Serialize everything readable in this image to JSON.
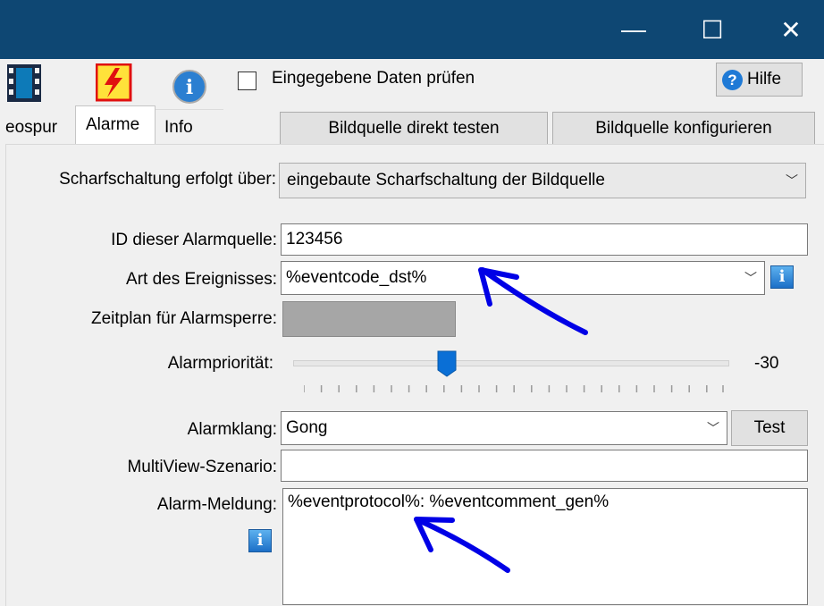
{
  "window": {
    "minimize_glyph": "—",
    "maximize_glyph": "☐",
    "close_glyph": "✕",
    "titlebar_color": "#0e4773"
  },
  "toolbar": {
    "icons": [
      "film-strip-icon",
      "alarm-lightning-icon",
      "info-circle-icon"
    ],
    "check_label": "Eingegebene Daten prüfen",
    "check_checked": false,
    "help_label": "Hilfe"
  },
  "tabs": {
    "items": [
      "eospur",
      "Alarme",
      "Info"
    ],
    "selected": "Alarme"
  },
  "buttons": {
    "test_source": "Bildquelle direkt testen",
    "configure_source": "Bildquelle konfigurieren",
    "test_sound": "Test"
  },
  "form": {
    "arming_label": "Scharfschaltung erfolgt über:",
    "arming_value": "eingebaute Scharfschaltung der Bildquelle",
    "id_label": "ID dieser Alarmquelle:",
    "id_value": "123456",
    "event_label": "Art des Ereignisses:",
    "event_value": "%eventcode_dst%",
    "schedule_label": "Zeitplan für Alarmsperre:",
    "priority_label": "Alarmpriorität:",
    "priority_value": "-30",
    "sound_label": "Alarmklang:",
    "sound_value": "Gong",
    "multiview_label": "MultiView-Szenario:",
    "multiview_value": "",
    "message_label": "Alarm-Meldung:",
    "message_value": "%eventprotocol%: %eventcomment_gen%"
  },
  "annotations": {
    "arrow_color": "#0000e6"
  }
}
